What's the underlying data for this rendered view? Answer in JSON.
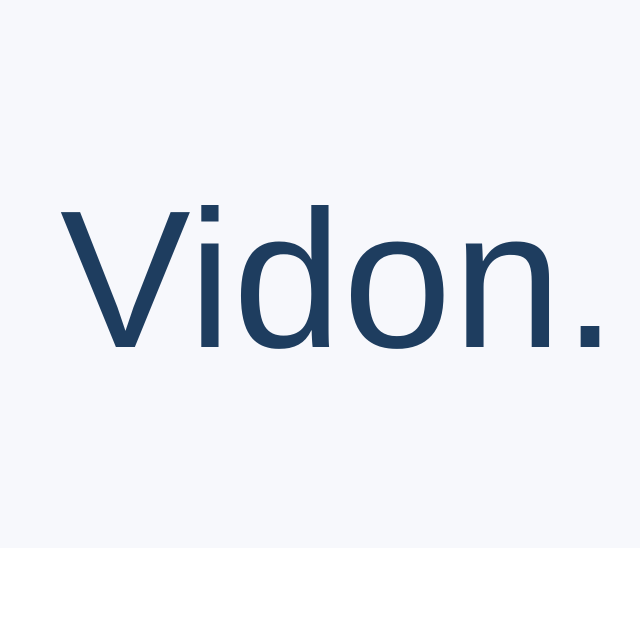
{
  "header": {
    "logo_text": "Vidon.",
    "background_color": "#f7f8fc",
    "logo_color": "#1e3d5f"
  },
  "page": {
    "background_color": "#ffffff"
  }
}
